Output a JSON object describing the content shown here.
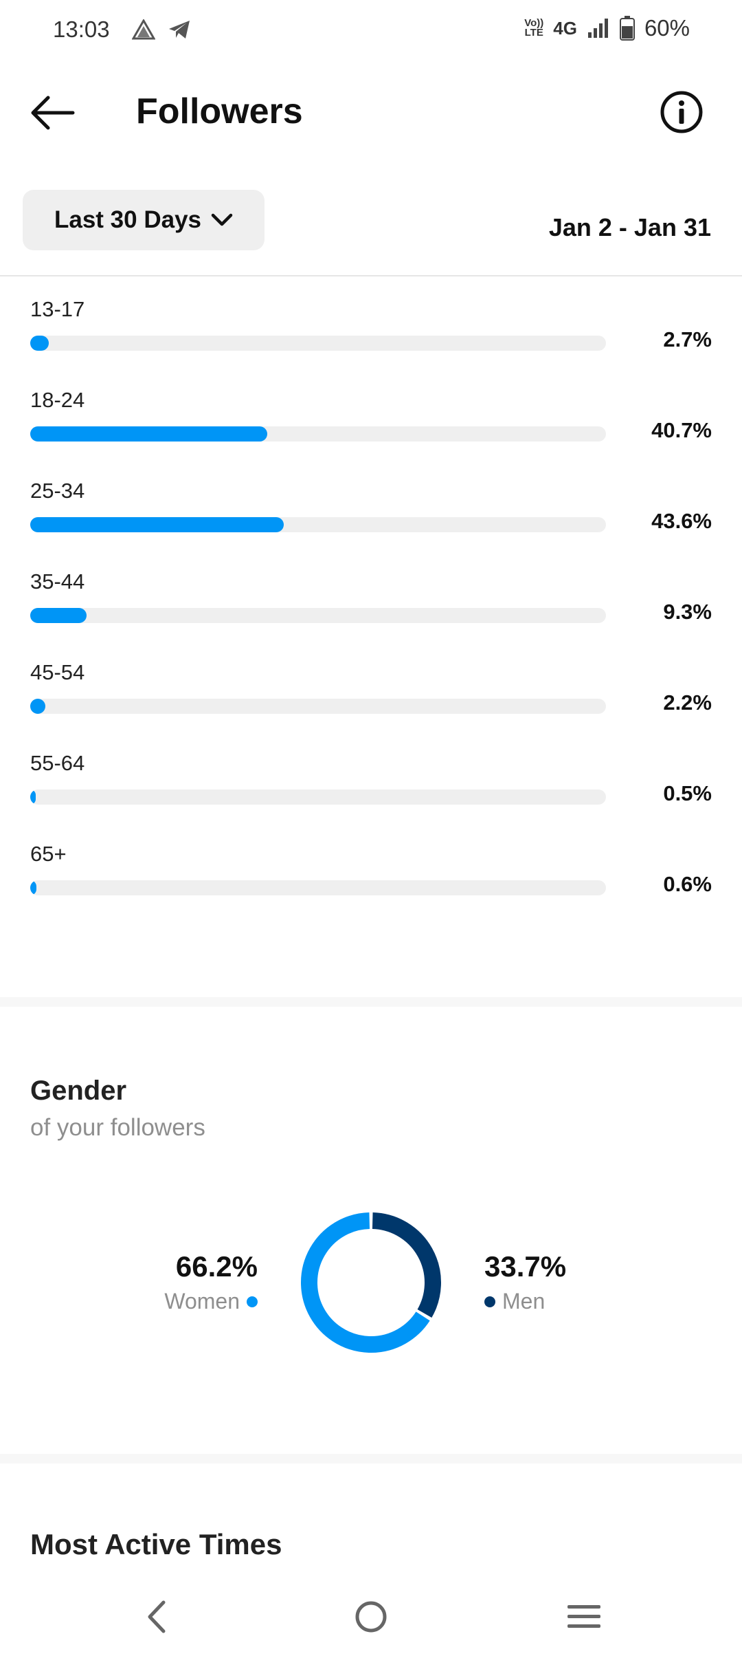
{
  "status_bar": {
    "time": "13:03",
    "left_icons": [
      "notification-icon",
      "telegram-icon"
    ],
    "volte": "Vo)) LTE",
    "network": "4G",
    "battery": "60%"
  },
  "header": {
    "title": "Followers",
    "back_icon": "back-arrow-icon",
    "info_icon": "info-icon"
  },
  "range": {
    "selector_label": "Last 30 Days",
    "date_range": "Jan 2 - Jan 31"
  },
  "age_groups": [
    {
      "label": "13-17",
      "percent_text": "2.7%",
      "value": 2.7
    },
    {
      "label": "18-24",
      "percent_text": "40.7%",
      "value": 40.7
    },
    {
      "label": "25-34",
      "percent_text": "43.6%",
      "value": 43.6
    },
    {
      "label": "35-44",
      "percent_text": "9.3%",
      "value": 9.3
    },
    {
      "label": "45-54",
      "percent_text": "2.2%",
      "value": 2.2
    },
    {
      "label": "55-64",
      "percent_text": "0.5%",
      "value": 0.5
    },
    {
      "label": "65+",
      "percent_text": "0.6%",
      "value": 0.6
    }
  ],
  "gender": {
    "title": "Gender",
    "subtitle": "of your followers",
    "women": {
      "percent_text": "66.2%",
      "label": "Women",
      "value": 66.2,
      "color": "#0095f6"
    },
    "men": {
      "percent_text": "33.7%",
      "label": "Men",
      "value": 33.7,
      "color": "#00376b"
    }
  },
  "most_active": {
    "title": "Most Active Times"
  },
  "colors": {
    "accent": "#0095f6",
    "dark_accent": "#00376b",
    "track": "#efefef"
  },
  "nav": [
    "back-icon",
    "home-icon",
    "menu-icon"
  ]
}
